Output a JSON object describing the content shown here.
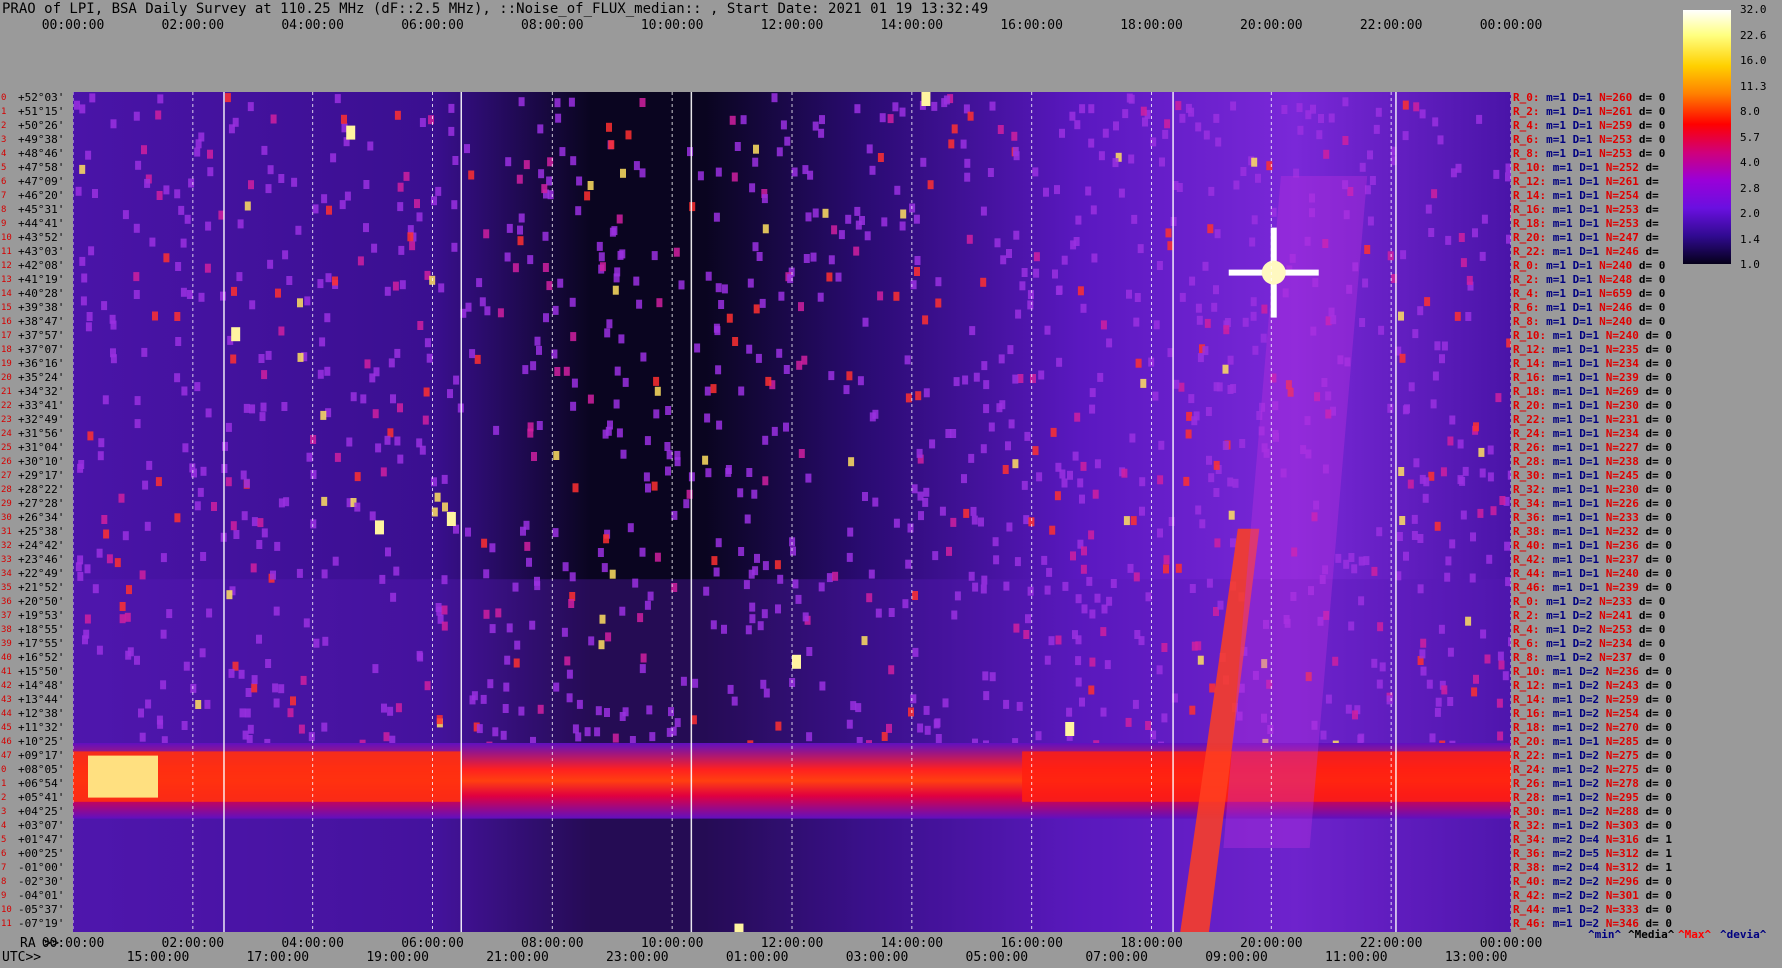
{
  "title": "PRAO of LPI, BSA Daily Survey at 110.25 MHz (dF::2.5 MHz), ::Noise_of_FLUX_median:: , Start Date: 2021 01 19 13:32:49",
  "top_ticks": [
    "00:00:00",
    "02:00:00",
    "04:00:00",
    "06:00:00",
    "08:00:00",
    "10:00:00",
    "12:00:00",
    "14:00:00",
    "16:00:00",
    "18:00:00",
    "20:00:00",
    "22:00:00",
    "00:00:00"
  ],
  "ra_prefix": "RA >>",
  "ra_ticks": [
    "00:00:00",
    "02:00:00",
    "04:00:00",
    "06:00:00",
    "08:00:00",
    "10:00:00",
    "12:00:00",
    "14:00:00",
    "16:00:00",
    "18:00:00",
    "20:00:00",
    "22:00:00",
    "00:00:00"
  ],
  "utc_prefix": "UTC>>",
  "utc_ticks": [
    "15:00:00",
    "17:00:00",
    "19:00:00",
    "21:00:00",
    "23:00:00",
    "01:00:00",
    "03:00:00",
    "05:00:00",
    "07:00:00",
    "09:00:00",
    "11:00:00",
    "13:00:00"
  ],
  "declinations": [
    "+52°03'",
    "+51°15'",
    "+50°26'",
    "+49°38'",
    "+48°46'",
    "+47°58'",
    "+47°09'",
    "+46°20'",
    "+45°31'",
    "+44°41'",
    "+43°52'",
    "+43°03'",
    "+42°08'",
    "+41°19'",
    "+40°28'",
    "+39°38'",
    "+38°47'",
    "+37°57'",
    "+37°07'",
    "+36°16'",
    "+35°24'",
    "+34°32'",
    "+33°41'",
    "+32°49'",
    "+31°56'",
    "+31°04'",
    "+30°10'",
    "+29°17'",
    "+28°22'",
    "+27°28'",
    "+26°34'",
    "+25°38'",
    "+24°42'",
    "+23°46'",
    "+22°49'",
    "+21°52'",
    "+20°50'",
    "+19°53'",
    "+18°55'",
    "+17°55'",
    "+16°52'",
    "+15°50'",
    "+14°48'",
    "+13°44'",
    "+12°38'",
    "+11°32'",
    "+10°25'",
    "+09°17'",
    "+08°05'",
    "+06°54'",
    "+05°41'",
    "+04°25'",
    "+03°07'",
    "+01°47'",
    "+00°25'",
    "-01°00'",
    "-02°30'",
    "-04°01'",
    "-05°37'",
    "-07°19'"
  ],
  "row_index": [
    "0",
    "1",
    "2",
    "3",
    "4",
    "5",
    "6",
    "7",
    "8",
    "9",
    "10",
    "11",
    "12",
    "13",
    "14",
    "15",
    "16",
    "17",
    "18",
    "19",
    "20",
    "21",
    "22",
    "23",
    "24",
    "25",
    "26",
    "27",
    "28",
    "29",
    "30",
    "31",
    "32",
    "33",
    "34",
    "35",
    "36",
    "37",
    "38",
    "39",
    "40",
    "41",
    "42",
    "43",
    "44",
    "45",
    "46",
    "47",
    "0",
    "1",
    "2",
    "3",
    "4",
    "5",
    "6",
    "7",
    "8",
    "9",
    "10",
    "11"
  ],
  "right_rows": [
    {
      "r": "R_0:",
      "m": "m=1",
      "d": "D=1",
      "n": "N=260",
      "dv": "d= 0"
    },
    {
      "r": "R_2:",
      "m": "m=1",
      "d": "D=1",
      "n": "N=261",
      "dv": "d= 0"
    },
    {
      "r": "R_4:",
      "m": "m=1",
      "d": "D=1",
      "n": "N=259",
      "dv": "d= 0"
    },
    {
      "r": "R_6:",
      "m": "m=1",
      "d": "D=1",
      "n": "N=253",
      "dv": "d= 0"
    },
    {
      "r": "R_8:",
      "m": "m=1",
      "d": "D=1",
      "n": "N=253",
      "dv": "d= 0"
    },
    {
      "r": "R_10:",
      "m": "m=1",
      "d": "D=1",
      "n": "N=252",
      "dv": "d="
    },
    {
      "r": "R_12:",
      "m": "m=1",
      "d": "D=1",
      "n": "N=261",
      "dv": "d="
    },
    {
      "r": "R_14:",
      "m": "m=1",
      "d": "D=1",
      "n": "N=254",
      "dv": "d="
    },
    {
      "r": "R_16:",
      "m": "m=1",
      "d": "D=1",
      "n": "N=253",
      "dv": "d="
    },
    {
      "r": "R_18:",
      "m": "m=1",
      "d": "D=1",
      "n": "N=253",
      "dv": "d="
    },
    {
      "r": "R_20:",
      "m": "m=1",
      "d": "D=1",
      "n": "N=247",
      "dv": "d="
    },
    {
      "r": "R_22:",
      "m": "m=1",
      "d": "D=1",
      "n": "N=246",
      "dv": "d="
    },
    {
      "r": "R_0:",
      "m": "m=1",
      "d": "D=1",
      "n": "N=240",
      "dv": "d= 0"
    },
    {
      "r": "R_2:",
      "m": "m=1",
      "d": "D=1",
      "n": "N=248",
      "dv": "d= 0"
    },
    {
      "r": "R_4:",
      "m": "m=1",
      "d": "D=1",
      "n": "N=659",
      "dv": "d= 0"
    },
    {
      "r": "R_6:",
      "m": "m=1",
      "d": "D=1",
      "n": "N=246",
      "dv": "d= 0"
    },
    {
      "r": "R_8:",
      "m": "m=1",
      "d": "D=1",
      "n": "N=240",
      "dv": "d= 0"
    },
    {
      "r": "R_10:",
      "m": "m=1",
      "d": "D=1",
      "n": "N=240",
      "dv": "d= 0"
    },
    {
      "r": "R_12:",
      "m": "m=1",
      "d": "D=1",
      "n": "N=235",
      "dv": "d= 0"
    },
    {
      "r": "R_14:",
      "m": "m=1",
      "d": "D=1",
      "n": "N=234",
      "dv": "d= 0"
    },
    {
      "r": "R_16:",
      "m": "m=1",
      "d": "D=1",
      "n": "N=239",
      "dv": "d= 0"
    },
    {
      "r": "R_18:",
      "m": "m=1",
      "d": "D=1",
      "n": "N=269",
      "dv": "d= 0"
    },
    {
      "r": "R_20:",
      "m": "m=1",
      "d": "D=1",
      "n": "N=230",
      "dv": "d= 0"
    },
    {
      "r": "R_22:",
      "m": "m=1",
      "d": "D=1",
      "n": "N=231",
      "dv": "d= 0"
    },
    {
      "r": "R_24:",
      "m": "m=1",
      "d": "D=1",
      "n": "N=234",
      "dv": "d= 0"
    },
    {
      "r": "R_26:",
      "m": "m=1",
      "d": "D=1",
      "n": "N=227",
      "dv": "d= 0"
    },
    {
      "r": "R_28:",
      "m": "m=1",
      "d": "D=1",
      "n": "N=238",
      "dv": "d= 0"
    },
    {
      "r": "R_30:",
      "m": "m=1",
      "d": "D=1",
      "n": "N=245",
      "dv": "d= 0"
    },
    {
      "r": "R_32:",
      "m": "m=1",
      "d": "D=1",
      "n": "N=230",
      "dv": "d= 0"
    },
    {
      "r": "R_34:",
      "m": "m=1",
      "d": "D=1",
      "n": "N=226",
      "dv": "d= 0"
    },
    {
      "r": "R_36:",
      "m": "m=1",
      "d": "D=1",
      "n": "N=233",
      "dv": "d= 0"
    },
    {
      "r": "R_38:",
      "m": "m=1",
      "d": "D=1",
      "n": "N=232",
      "dv": "d= 0"
    },
    {
      "r": "R_40:",
      "m": "m=1",
      "d": "D=1",
      "n": "N=236",
      "dv": "d= 0"
    },
    {
      "r": "R_42:",
      "m": "m=1",
      "d": "D=1",
      "n": "N=237",
      "dv": "d= 0"
    },
    {
      "r": "R_44:",
      "m": "m=1",
      "d": "D=1",
      "n": "N=240",
      "dv": "d= 0"
    },
    {
      "r": "R_46:",
      "m": "m=1",
      "d": "D=1",
      "n": "N=239",
      "dv": "d= 0"
    },
    {
      "r": "R_0:",
      "m": "m=1",
      "d": "D=2",
      "n": "N=233",
      "dv": "d= 0"
    },
    {
      "r": "R_2:",
      "m": "m=1",
      "d": "D=2",
      "n": "N=241",
      "dv": "d= 0"
    },
    {
      "r": "R_4:",
      "m": "m=1",
      "d": "D=2",
      "n": "N=253",
      "dv": "d= 0"
    },
    {
      "r": "R_6:",
      "m": "m=1",
      "d": "D=2",
      "n": "N=234",
      "dv": "d= 0"
    },
    {
      "r": "R_8:",
      "m": "m=1",
      "d": "D=2",
      "n": "N=237",
      "dv": "d= 0"
    },
    {
      "r": "R_10:",
      "m": "m=1",
      "d": "D=2",
      "n": "N=236",
      "dv": "d= 0"
    },
    {
      "r": "R_12:",
      "m": "m=1",
      "d": "D=2",
      "n": "N=243",
      "dv": "d= 0"
    },
    {
      "r": "R_14:",
      "m": "m=1",
      "d": "D=2",
      "n": "N=259",
      "dv": "d= 0"
    },
    {
      "r": "R_16:",
      "m": "m=1",
      "d": "D=2",
      "n": "N=254",
      "dv": "d= 0"
    },
    {
      "r": "R_18:",
      "m": "m=1",
      "d": "D=2",
      "n": "N=270",
      "dv": "d= 0"
    },
    {
      "r": "R_20:",
      "m": "m=1",
      "d": "D=1",
      "n": "N=285",
      "dv": "d= 0"
    },
    {
      "r": "R_22:",
      "m": "m=1",
      "d": "D=2",
      "n": "N=275",
      "dv": "d= 0"
    },
    {
      "r": "R_24:",
      "m": "m=1",
      "d": "D=2",
      "n": "N=275",
      "dv": "d= 0"
    },
    {
      "r": "R_26:",
      "m": "m=1",
      "d": "D=2",
      "n": "N=278",
      "dv": "d= 0"
    },
    {
      "r": "R_28:",
      "m": "m=1",
      "d": "D=2",
      "n": "N=295",
      "dv": "d= 0"
    },
    {
      "r": "R_30:",
      "m": "m=1",
      "d": "D=2",
      "n": "N=288",
      "dv": "d= 0"
    },
    {
      "r": "R_32:",
      "m": "m=1",
      "d": "D=2",
      "n": "N=303",
      "dv": "d= 0"
    },
    {
      "r": "R_34:",
      "m": "m=2",
      "d": "D=4",
      "n": "N=316",
      "dv": "d= 1"
    },
    {
      "r": "R_36:",
      "m": "m=2",
      "d": "D=5",
      "n": "N=312",
      "dv": "d= 1"
    },
    {
      "r": "R_38:",
      "m": "m=2",
      "d": "D=4",
      "n": "N=312",
      "dv": "d= 1"
    },
    {
      "r": "R_40:",
      "m": "m=2",
      "d": "D=2",
      "n": "N=296",
      "dv": "d= 0"
    },
    {
      "r": "R_42:",
      "m": "m=2",
      "d": "D=2",
      "n": "N=301",
      "dv": "d= 0"
    },
    {
      "r": "R_44:",
      "m": "m=1",
      "d": "D=2",
      "n": "N=333",
      "dv": "d= 0"
    },
    {
      "r": "R_46:",
      "m": "m=1",
      "d": "D=2",
      "n": "N=346",
      "dv": "d= 0"
    }
  ],
  "colorbar_ticks": [
    "32.0",
    "22.6",
    "16.0",
    "11.3",
    "8.0",
    "5.7",
    "4.0",
    "2.8",
    "2.0",
    "1.4",
    "1.0"
  ],
  "legend": {
    "min": "^min^",
    "median": "^Media^",
    "max": "^Max^",
    "devia": "^devia^"
  },
  "colors": {
    "background": "#9a9a9a",
    "max_label": "#ff0000",
    "min_label": "#000080"
  }
}
